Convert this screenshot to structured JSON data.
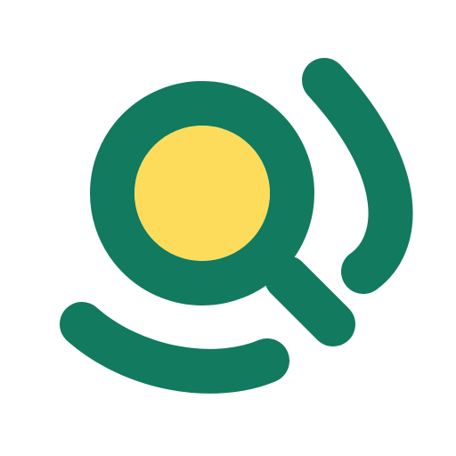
{
  "logo": {
    "icon": "magnifier-with-signal-arcs-logo",
    "colors": {
      "background": "#ffffff",
      "primary": "#127a5e",
      "lens_fill": "#fddc5c"
    }
  }
}
